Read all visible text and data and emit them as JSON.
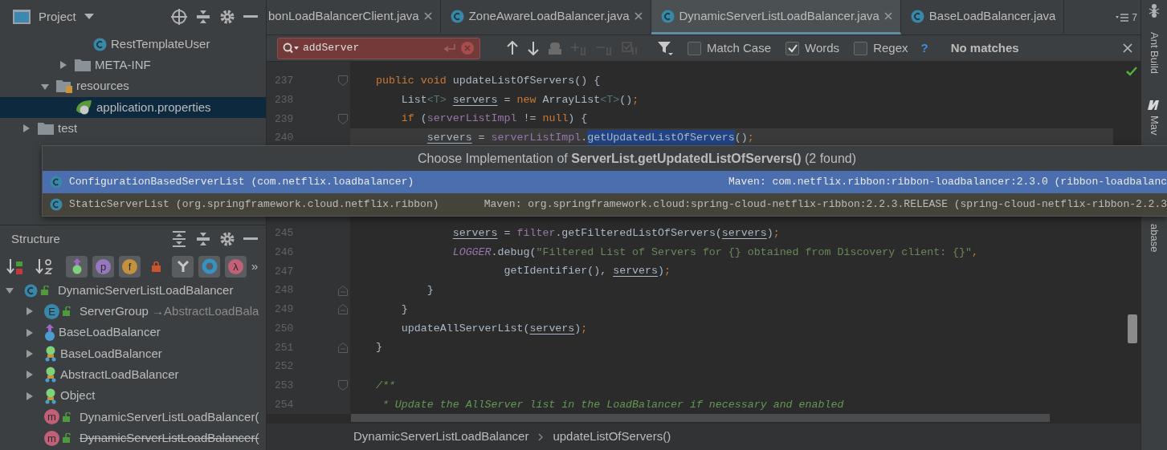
{
  "project_panel": {
    "title": "Project",
    "tree": [
      {
        "children": [
          {
            "children": [
              {
                "children": [
                  {
                    "label": "RestTemplateUser",
                    "kind": "class",
                    "selected": false
                  }
                ]
              },
              {
                "label": "META-INF",
                "kind": "folder",
                "expanded": false,
                "selected": false
              }
            ]
          },
          {
            "label": "resources",
            "kind": "resources-folder",
            "expanded": true,
            "selected": false,
            "children": [
              {
                "label": "application.properties",
                "kind": "spring-file",
                "selected": true
              }
            ]
          }
        ]
      },
      {
        "label": "test",
        "kind": "folder",
        "expanded": false,
        "selected": false
      }
    ]
  },
  "structure_panel": {
    "title": "Structure",
    "toolbar": [
      {
        "kind": "sort-visibility"
      },
      {
        "kind": "sort-alpha"
      },
      {
        "kind": "inherited",
        "selected": true
      },
      {
        "kind": "letter",
        "glyph": "p",
        "color": "#9678c0",
        "selected": true
      },
      {
        "kind": "letter",
        "glyph": "f",
        "color": "#c4913e",
        "selected": true
      },
      {
        "kind": "lock",
        "selected": false
      },
      {
        "kind": "fork",
        "selected": true
      },
      {
        "kind": "ring",
        "selected": true
      },
      {
        "kind": "letter",
        "glyph": "λ",
        "color": "#c45f78",
        "selected": true
      },
      {
        "kind": "more",
        "glyph": "»"
      }
    ],
    "tree": [
      {
        "label": "DynamicServerListLoadBalancer",
        "kind": "class",
        "public": true,
        "expanded": true,
        "children": [
          {
            "label": "ServerGroup",
            "suffix": " →AbstractLoadBala",
            "kind": "enum",
            "icon_letter": "E",
            "public": true,
            "expanded": false
          },
          {
            "label": "BaseLoadBalancer",
            "kind": "interface",
            "expanded": false
          },
          {
            "label": "BaseLoadBalancer",
            "kind": "superclass",
            "expanded": false
          },
          {
            "label": "AbstractLoadBalancer",
            "kind": "superclass",
            "expanded": false
          },
          {
            "label": "Object",
            "kind": "superclass",
            "expanded": false
          },
          {
            "label": "DynamicServerListLoadBalancer(",
            "kind": "method",
            "icon_letter": "m",
            "public": true,
            "deprecated": false
          },
          {
            "label": "DynamicServerListLoadBalancer(",
            "kind": "method",
            "icon_letter": "m",
            "public": true,
            "deprecated": true
          }
        ]
      }
    ]
  },
  "editor_tabs": [
    {
      "label": "bonLoadBalancerClient.java",
      "icon": false,
      "closable": true,
      "selected": false
    },
    {
      "label": "ZoneAwareLoadBalancer.java",
      "icon": true,
      "closable": true,
      "selected": false
    },
    {
      "label": "DynamicServerListLoadBalancer.java",
      "icon": true,
      "closable": true,
      "selected": true
    },
    {
      "label": "BaseLoadBalancer.java",
      "icon": true,
      "closable": false,
      "selected": false
    }
  ],
  "tab_overflow": {
    "count": "7"
  },
  "find_bar": {
    "query": "addServer",
    "options": [
      {
        "label": "Match Case",
        "checked": false
      },
      {
        "label": "Words",
        "checked": true
      },
      {
        "label": "Regex",
        "checked": false
      }
    ],
    "help": "?",
    "status": "No matches"
  },
  "code": [
    {
      "number": "237",
      "kind": "fold-start",
      "current": false,
      "tokens": [
        {
          "t": "    public void",
          "kind": "keyword"
        },
        {
          "t": " updateListOfServers() {",
          "kind": "plain"
        }
      ]
    },
    {
      "number": "238",
      "kind": "plain",
      "current": false,
      "tokens": [
        {
          "t": "        List",
          "kind": "plain"
        },
        {
          "t": "<T>",
          "kind": "type"
        },
        {
          "t": " servers",
          "kind": "var"
        },
        {
          "t": " =",
          "kind": "plain"
        },
        {
          "t": " new",
          "kind": "keyword"
        },
        {
          "t": " ArrayList",
          "kind": "plain"
        },
        {
          "t": "<T>",
          "kind": "type"
        },
        {
          "t": "()",
          "kind": "plain"
        },
        {
          "t": ";",
          "kind": "keyword"
        }
      ]
    },
    {
      "number": "239",
      "kind": "fold-start",
      "current": false,
      "tokens": [
        {
          "t": "        if",
          "kind": "keyword"
        },
        {
          "t": " (",
          "kind": "plain"
        },
        {
          "t": "serverListImpl",
          "kind": "field"
        },
        {
          "t": " !=",
          "kind": "plain"
        },
        {
          "t": " null",
          "kind": "keyword"
        },
        {
          "t": ") {",
          "kind": "plain"
        }
      ]
    },
    {
      "number": "240",
      "kind": "plain",
      "current": true,
      "tokens": [
        {
          "t": "            servers",
          "kind": "var"
        },
        {
          "t": " =",
          "kind": "plain"
        },
        {
          "t": " serverListImpl",
          "kind": "field"
        },
        {
          "t": ".",
          "kind": "plain"
        },
        {
          "t": "getUpdatedListOfServers",
          "kind": "match"
        },
        {
          "t": "()",
          "kind": "plain"
        },
        {
          "t": ";",
          "kind": "keyword"
        }
      ]
    },
    {
      "number": "245",
      "kind": "plain",
      "current": false,
      "tokens": [
        {
          "t": "                servers",
          "kind": "var"
        },
        {
          "t": " =",
          "kind": "plain"
        },
        {
          "t": " filter",
          "kind": "field"
        },
        {
          "t": ".getFilteredListOfServers(",
          "kind": "plain"
        },
        {
          "t": "servers",
          "kind": "var"
        },
        {
          "t": ")",
          "kind": "plain"
        },
        {
          "t": ";",
          "kind": "keyword"
        }
      ]
    },
    {
      "number": "246",
      "kind": "plain",
      "current": false,
      "tokens": [
        {
          "t": "                LOGGER",
          "kind": "static"
        },
        {
          "t": ".debug(",
          "kind": "plain"
        },
        {
          "t": "\"Filtered List of Servers for {} obtained from Discovery client: {}\"",
          "kind": "string"
        },
        {
          "t": ",",
          "kind": "keyword"
        }
      ]
    },
    {
      "number": "247",
      "kind": "plain",
      "current": false,
      "tokens": [
        {
          "t": "                        getIdentifier(),",
          "kind": "plain"
        },
        {
          "t": " servers",
          "kind": "var"
        },
        {
          "t": ")",
          "kind": "plain"
        },
        {
          "t": ";",
          "kind": "keyword"
        }
      ]
    },
    {
      "number": "248",
      "kind": "fold-end",
      "current": false,
      "tokens": [
        {
          "t": "            }",
          "kind": "plain"
        }
      ]
    },
    {
      "number": "249",
      "kind": "fold-end",
      "current": false,
      "tokens": [
        {
          "t": "        }",
          "kind": "plain"
        }
      ]
    },
    {
      "number": "250",
      "kind": "plain",
      "current": false,
      "tokens": [
        {
          "t": "        updateAllServerList(",
          "kind": "plain"
        },
        {
          "t": "servers",
          "kind": "var"
        },
        {
          "t": ")",
          "kind": "plain"
        },
        {
          "t": ";",
          "kind": "keyword"
        }
      ]
    },
    {
      "number": "251",
      "kind": "fold-end",
      "current": false,
      "tokens": [
        {
          "t": "    }",
          "kind": "plain"
        }
      ]
    },
    {
      "number": "252",
      "kind": "plain",
      "current": false
    },
    {
      "number": "253",
      "kind": "fold-start",
      "current": false,
      "tokens": [
        {
          "t": "    /**",
          "kind": "doc"
        }
      ]
    },
    {
      "number": "254",
      "kind": "plain",
      "current": false,
      "tokens": [
        {
          "t": "     * Update the AllServer list in the LoadBalancer if necessary and enabled",
          "kind": "doc"
        }
      ]
    }
  ],
  "implementation_popup": {
    "title": "Choose Implementation of **ServerList.getUpdatedListOfServers()** (2 found)",
    "rows": [
      {
        "name": "ConfigurationBasedServerList",
        "package": "(com.netflix.loadbalancer)",
        "source": "Maven: com.netflix.ribbon:ribbon-loadbalancer:2.3.0 (ribbon-loadbalanc",
        "selected": true
      },
      {
        "name": "StaticServerList",
        "package": "(org.springframework.cloud.netflix.ribbon)",
        "source": "Maven: org.springframework.cloud:spring-cloud-netflix-ribbon:2.2.3.RELEASE (spring-cloud-netflix-ribbon-2.2.3",
        "selected": false
      }
    ]
  },
  "breadcrumbs": [
    "DynamicServerListLoadBalancer",
    "updateListOfServers()"
  ],
  "tool_strip": [
    {
      "label": "Ant Build",
      "kind": "ant"
    },
    {
      "label": "Mav",
      "kind": "maven"
    },
    {
      "label": "abase",
      "kind": "database"
    }
  ]
}
